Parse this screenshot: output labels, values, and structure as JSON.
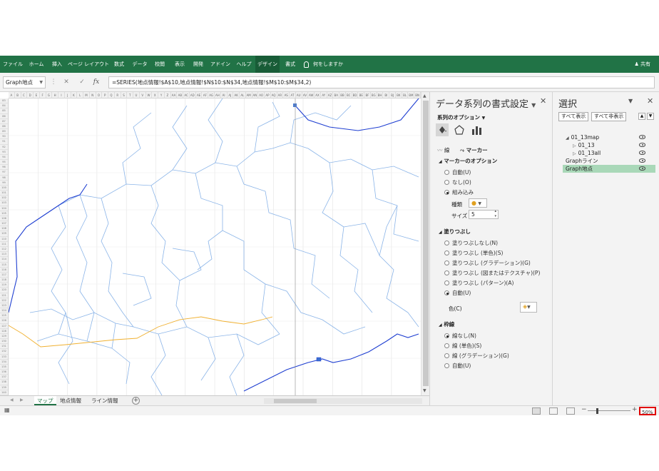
{
  "ribbon": {
    "tabs": [
      "ファイル",
      "ホーム",
      "挿入",
      "ページ レイアウト",
      "数式",
      "データ",
      "校閲",
      "表示",
      "開発",
      "アドイン",
      "ヘルプ",
      "デザイン",
      "書式"
    ],
    "active_tab": "デザイン",
    "tell_me": "何をしますか",
    "share": "共有",
    "color": "#217346"
  },
  "formula_bar": {
    "name_box": "Graph地点",
    "cancel": "✕",
    "enter": "✓",
    "fx": "fx",
    "formula": "=SERIES(地点情報!$A$10,地点情報!$N$10:$N$34,地点情報!$M$10:$M$34,2)"
  },
  "sheet": {
    "columns": [
      "A",
      "B",
      "C",
      "D",
      "E",
      "F",
      "G",
      "H",
      "I",
      "J",
      "K",
      "L",
      "M",
      "N",
      "O",
      "P",
      "Q",
      "R",
      "S",
      "T",
      "U",
      "V",
      "W",
      "X",
      "Y",
      "Z",
      "AA",
      "AB",
      "AC",
      "AD",
      "AE",
      "AF",
      "AG",
      "AH",
      "AI",
      "AJ",
      "AK",
      "AL",
      "AM",
      "AN",
      "AO",
      "AP",
      "AQ",
      "AR",
      "AS",
      "AT",
      "AU",
      "AV",
      "AW",
      "AX",
      "AY",
      "AZ",
      "BA",
      "BB",
      "BC",
      "BD",
      "BE",
      "BF",
      "BG",
      "BH",
      "BI",
      "BJ",
      "BK",
      "BL",
      "BM",
      "BN"
    ],
    "first_row": 83,
    "last_row": 140,
    "tabs": [
      "マップ",
      "地点情報",
      "ライン情報"
    ],
    "active_tab": "マップ"
  },
  "status": {
    "zoom": "50%"
  },
  "format_pane": {
    "title": "データ系列の書式設定",
    "options_label": "系列のオプション",
    "line_tab": "線",
    "marker_tab": "マーカー",
    "marker_options": {
      "header": "マーカーのオプション",
      "options": [
        "自動(U)",
        "なし(O)",
        "組み込み"
      ],
      "selected": "組み込み",
      "type_label": "種類",
      "size_label": "サイズ",
      "size_value": "5"
    },
    "fill": {
      "header": "塗りつぶし",
      "options": [
        "塗りつぶしなし(N)",
        "塗りつぶし (単色)(S)",
        "塗りつぶし (グラデーション)(G)",
        "塗りつぶし (図またはテクスチャ)(P)",
        "塗りつぶし (パターン)(A)",
        "自動(U)"
      ],
      "selected": "自動(U)",
      "color_label": "色(C)"
    },
    "border": {
      "header": "枠線",
      "options": [
        "線なし(N)",
        "線 (単色)(S)",
        "線 (グラデーション)(G)",
        "自動(U)"
      ],
      "selected": "線なし(N)"
    }
  },
  "selection_pane": {
    "title": "選択",
    "show_all": "すべて表示",
    "hide_all": "すべて非表示",
    "items": [
      {
        "label": "01_13map",
        "level": 0,
        "expanded": true,
        "selected": false
      },
      {
        "label": "01_13",
        "level": 1,
        "expanded": false,
        "selected": false
      },
      {
        "label": "01_13all",
        "level": 1,
        "expanded": false,
        "selected": false
      },
      {
        "label": "Graphライン",
        "level": 0,
        "expanded": null,
        "selected": false
      },
      {
        "label": "Graph地点",
        "level": 0,
        "expanded": null,
        "selected": true
      }
    ]
  }
}
